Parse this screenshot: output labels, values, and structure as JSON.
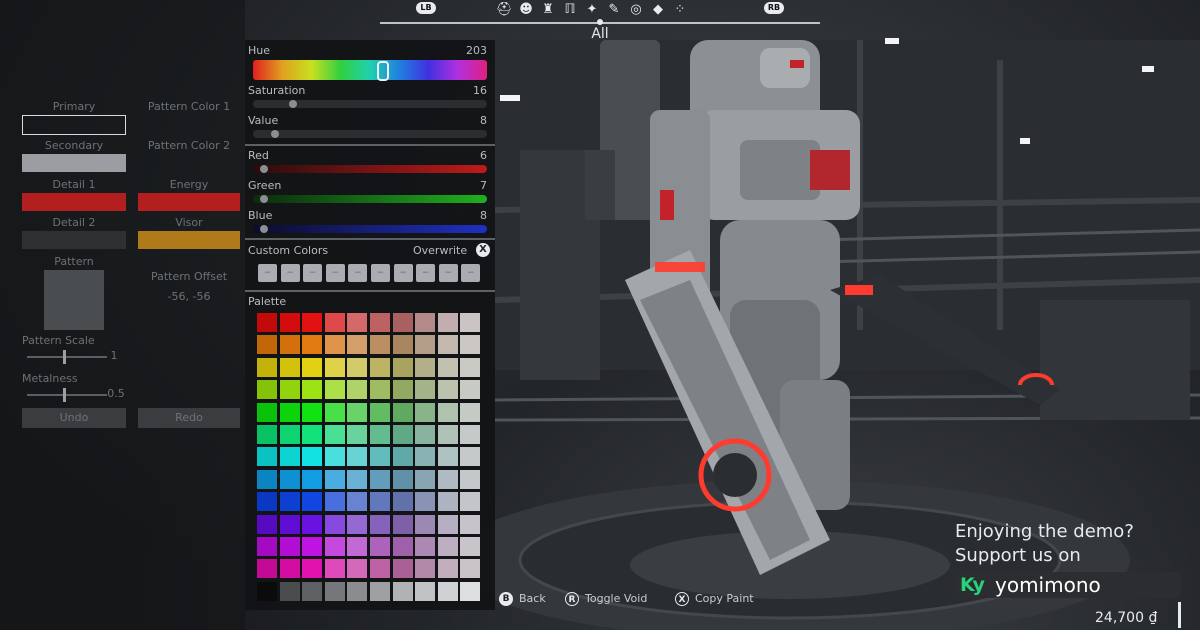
{
  "topbar": {
    "shoulder_left": "LB",
    "shoulder_right": "RB",
    "categories": [
      "helmet-icon",
      "mask-icon",
      "torso-icon",
      "legs-icon",
      "arm-icon",
      "gun-icon",
      "target-icon",
      "part-icon",
      "dots-icon"
    ],
    "category_label": "All"
  },
  "left_panel": {
    "primary": {
      "label": "Primary",
      "color": "#3c3e40"
    },
    "secondary": {
      "label": "Secondary",
      "color": "#9a9ea2"
    },
    "detail1": {
      "label": "Detail 1",
      "color": "#b31e1e"
    },
    "detail2": {
      "label": "Detail 2",
      "color": "#2e3032"
    },
    "pattern_color_1": {
      "label": "Pattern Color 1"
    },
    "pattern_color_2": {
      "label": "Pattern Color 2"
    },
    "energy": {
      "label": "Energy",
      "color": "#b31e1e"
    },
    "visor": {
      "label": "Visor",
      "color": "#b07a1a"
    },
    "pattern": {
      "label": "Pattern",
      "color": "#4a4d50"
    },
    "pattern_offset": {
      "label": "Pattern Offset",
      "value": "-56, -56"
    },
    "pattern_scale": {
      "label": "Pattern Scale",
      "value": "1",
      "level": 0.47
    },
    "metalness": {
      "label": "Metalness",
      "value": "0.5",
      "level": 0.47
    },
    "undo_label": "Undo",
    "redo_label": "Redo"
  },
  "picker": {
    "hue": {
      "label": "Hue",
      "value": "203",
      "level": 0.56
    },
    "saturation": {
      "label": "Saturation",
      "value": "16",
      "level": 0.16
    },
    "value": {
      "label": "Value",
      "value": "8",
      "level": 0.08
    },
    "red": {
      "label": "Red",
      "value": "6",
      "level": 0.03
    },
    "green": {
      "label": "Green",
      "value": "7",
      "level": 0.03
    },
    "blue": {
      "label": "Blue",
      "value": "8",
      "level": 0.03
    },
    "custom_colors_label": "Custom Colors",
    "overwrite_label": "Overwrite",
    "overwrite_button": "X",
    "custom_slot_count": 10,
    "palette_label": "Palette"
  },
  "hints": {
    "back": {
      "button": "B",
      "label": "Back"
    },
    "toggle_void": {
      "button": "R",
      "label": "Toggle Void"
    },
    "copy_paint": {
      "button": "X",
      "label": "Copy Paint"
    }
  },
  "promo": {
    "line1": "Enjoying the demo?",
    "line2": "Support us on",
    "kofi_logo": "Ky",
    "kofi_word": "yomimono"
  },
  "currency": {
    "amount": "24,700",
    "symbol": "₫"
  }
}
